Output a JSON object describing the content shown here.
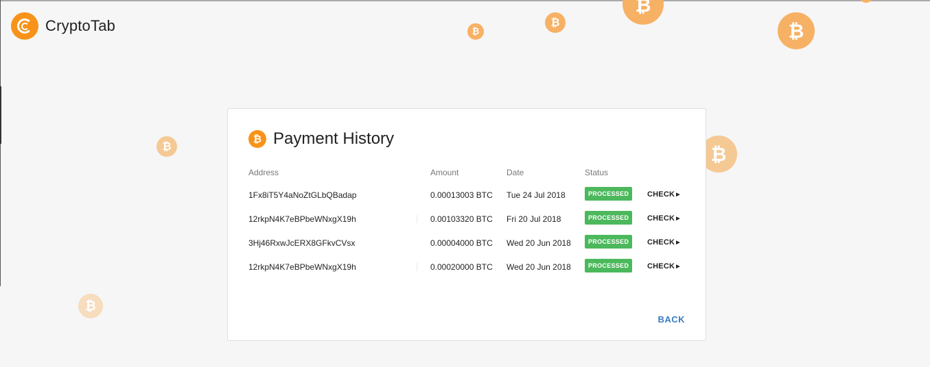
{
  "app": {
    "name": "CryptoTab",
    "colors": {
      "brand": "#f7931a",
      "processed": "#4cb85c",
      "link": "#3c7cc0",
      "background": "#f6f6f6"
    }
  },
  "decor": {
    "coin_icon": "bitcoin-icon",
    "coin_symbol": "₿"
  },
  "card": {
    "title": "Payment History",
    "title_icon": "bitcoin-icon",
    "columns": {
      "address": "Address",
      "amount": "Amount",
      "date": "Date",
      "status": "Status"
    },
    "rows": [
      {
        "address": "1Fx8iT5Y4aNoZtGLbQBadap",
        "amount": "0.00013003 BTC",
        "date": "Tue 24 Jul 2018",
        "status": "PROCESSED",
        "action": "CHECK"
      },
      {
        "address": "12rkpN4K7eBPbeWNxgX19h",
        "amount": "0.00103320 BTC",
        "date": "Fri 20 Jul 2018",
        "status": "PROCESSED",
        "action": "CHECK"
      },
      {
        "address": "3Hj46RxwJcERX8GFkvCVsx",
        "amount": "0.00004000 BTC",
        "date": "Wed 20 Jun 2018",
        "status": "PROCESSED",
        "action": "CHECK"
      },
      {
        "address": "12rkpN4K7eBPbeWNxgX19h",
        "amount": "0.00020000 BTC",
        "date": "Wed 20 Jun 2018",
        "status": "PROCESSED",
        "action": "CHECK"
      }
    ],
    "back_label": "BACK"
  }
}
